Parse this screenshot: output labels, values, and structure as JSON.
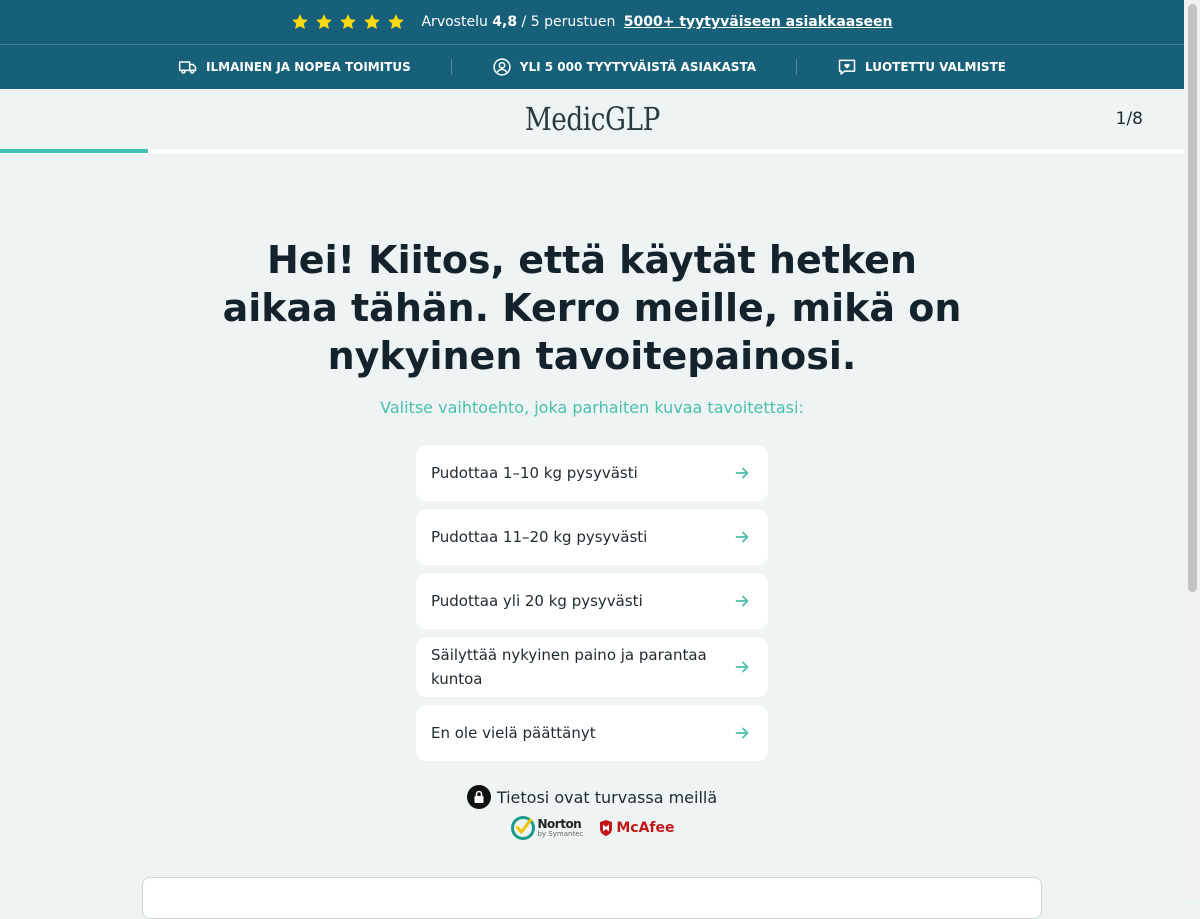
{
  "topbar": {
    "rating_prefix": "Arvostelu",
    "rating_value": "4,8",
    "rating_suffix": "/ 5 perustuen",
    "rating_link": "5000+ tyytyväiseen asiakkaaseen",
    "star_color": "#f5d90a"
  },
  "features": [
    {
      "icon": "truck-icon",
      "label": "ILMAINEN JA NOPEA TOIMITUS"
    },
    {
      "icon": "user-circle-icon",
      "label": "YLI 5 000 TYYTYVÄISTÄ ASIAKASTA"
    },
    {
      "icon": "chat-heart-icon",
      "label": "LUOTETTU VALMISTE"
    }
  ],
  "header": {
    "logo": "MedicGLP",
    "step": "1/8"
  },
  "progress": {
    "fraction": 0.125,
    "accent": "#47c1b2"
  },
  "question": {
    "title": "Hei! Kiitos, että käytät hetken aikaa tähän. Kerro meille, mikä on nykyinen tavoitepainosi.",
    "subtitle": "Valitse vaihtoehto, joka parhaiten kuvaa tavoitettasi:"
  },
  "options": [
    "Pudottaa 1–10 kg pysyvästi",
    "Pudottaa 11–20 kg pysyvästi",
    "Pudottaa yli 20 kg pysyvästi",
    "Säilyttää nykyinen paino ja parantaa kuntoa",
    "En ole vielä päättänyt"
  ],
  "security": {
    "text": "Tietosi ovat turvassa meillä",
    "norton": "Norton",
    "norton_sub": "by Symantec",
    "mcafee": "McAfee"
  }
}
